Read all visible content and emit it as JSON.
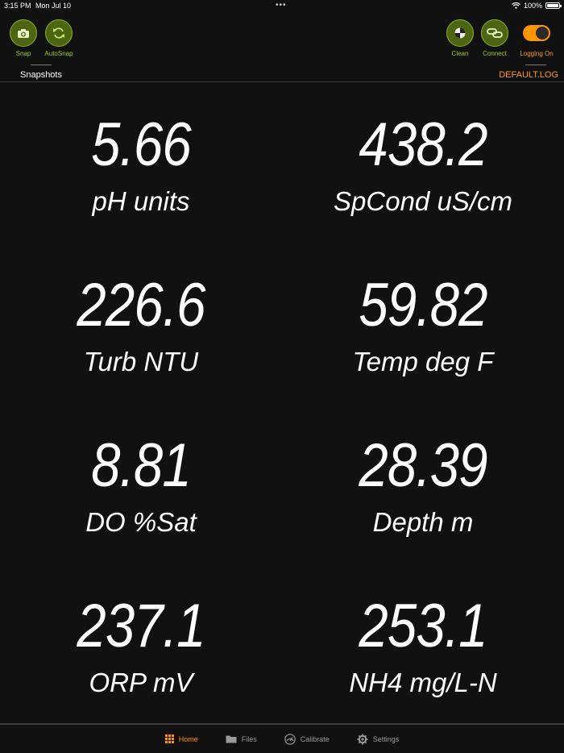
{
  "status_bar": {
    "time": "3:15 PM",
    "date": "Mon Jul 10",
    "multitask": "•••",
    "battery": "100%"
  },
  "toolbar": {
    "snap_label": "Snap",
    "autosnap_label": "AutoSnap",
    "clean_label": "Clean",
    "connect_label": "Connect",
    "logging_label": "Logging On",
    "logging_on": true,
    "snapshots_title": "Snapshots",
    "log_file": "DEFAULT.LOG"
  },
  "readings": [
    {
      "value": "5.66",
      "unit": "pH units"
    },
    {
      "value": "438.2",
      "unit": "SpCond uS/cm"
    },
    {
      "value": "226.6",
      "unit": "Turb NTU"
    },
    {
      "value": "59.82",
      "unit": "Temp deg F"
    },
    {
      "value": "8.81",
      "unit": "DO %Sat"
    },
    {
      "value": "28.39",
      "unit": "Depth m"
    },
    {
      "value": "237.1",
      "unit": "ORP mV"
    },
    {
      "value": "253.1",
      "unit": "NH4 mg/L-N"
    }
  ],
  "tabs": [
    {
      "label": "Home",
      "icon": "grid-icon",
      "active": true
    },
    {
      "label": "Files",
      "icon": "folder-icon",
      "active": false
    },
    {
      "label": "Calibrate",
      "icon": "gauge-icon",
      "active": false
    },
    {
      "label": "Settings",
      "icon": "gear-icon",
      "active": false
    }
  ],
  "colors": {
    "background": "#111111",
    "accent_green": "#9ccc2a",
    "accent_orange": "#ff9500"
  }
}
